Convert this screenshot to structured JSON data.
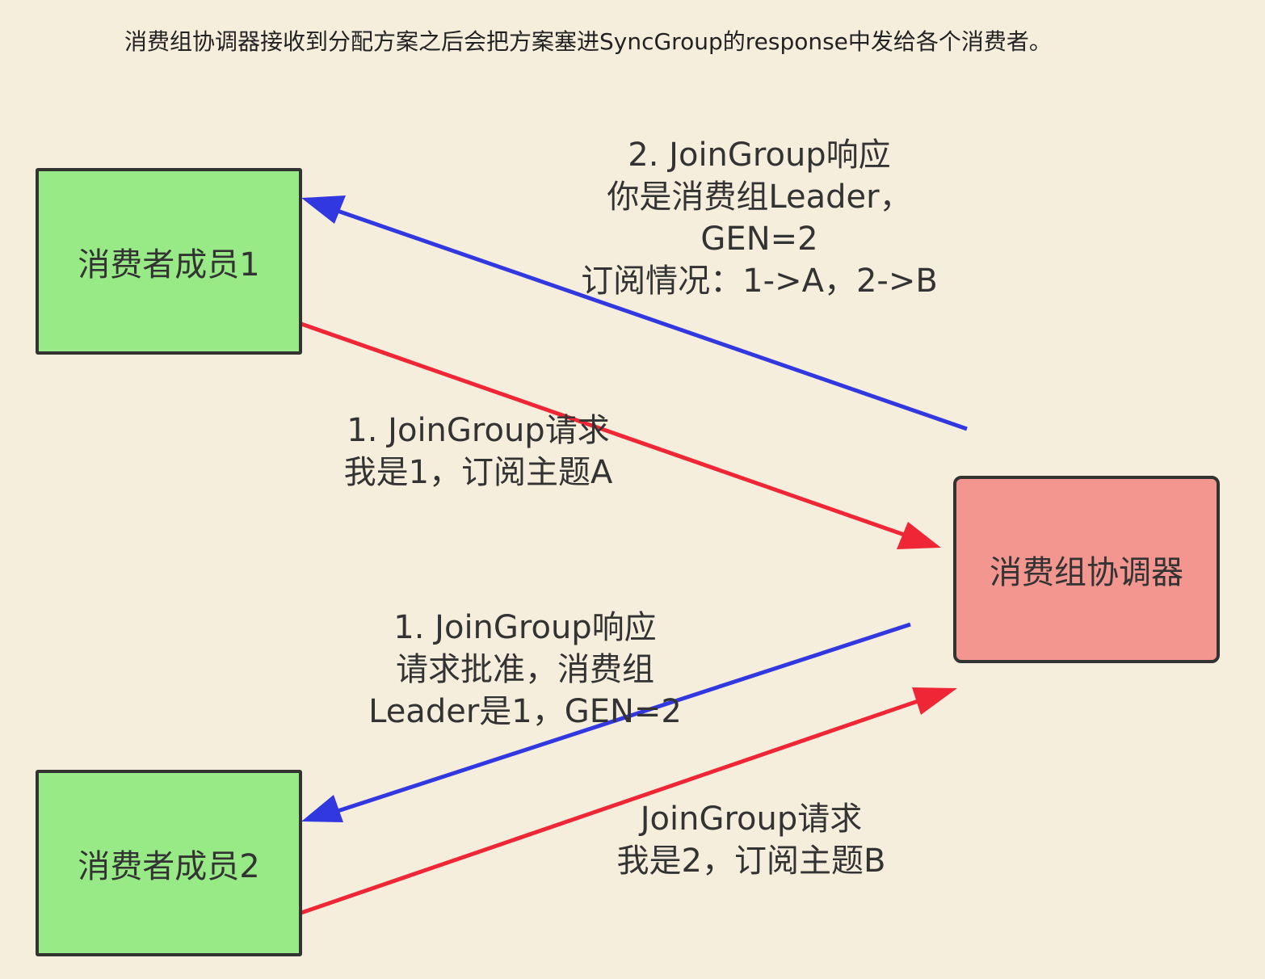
{
  "caption": "消费组协调器接收到分配方案之后会把方案塞进SyncGroup的response中发给各个消费者。",
  "nodes": {
    "member1": "消费者成员1",
    "member2": "消费者成员2",
    "coordinator": "消费组协调器"
  },
  "edges": {
    "join_request_1": {
      "line1": "1. JoinGroup请求",
      "line2": "我是1，订阅主题A"
    },
    "join_response_leader": {
      "line1": "2. JoinGroup响应",
      "line2": "你是消费组Leader，",
      "line3": "GEN=2",
      "line4": "订阅情况：1->A，2->B"
    },
    "join_response_2": {
      "line1": "1. JoinGroup响应",
      "line2": "请求批准，消费组",
      "line3": "Leader是1，GEN=2"
    },
    "join_request_2": {
      "line1": "JoinGroup请求",
      "line2": "我是2，订阅主题B"
    }
  },
  "colors": {
    "request": "#ef2636",
    "response": "#3238e0",
    "member_fill": "#98ea86",
    "coordinator_fill": "#f2968f",
    "background": "#f6eedc"
  }
}
